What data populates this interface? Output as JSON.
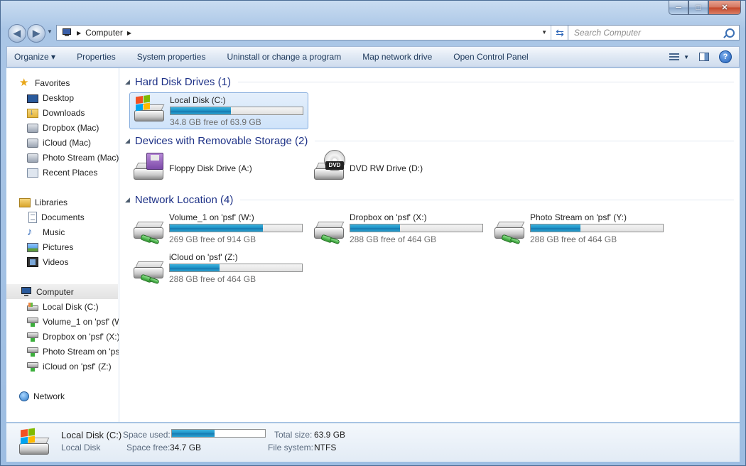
{
  "window": {
    "caption_minimize": "─",
    "caption_maximize": "□",
    "caption_close": "✕"
  },
  "address": {
    "location": "Computer",
    "icon": "computer-icon"
  },
  "search": {
    "placeholder": "Search Computer"
  },
  "toolbar": {
    "organize": "Organize ▾",
    "properties": "Properties",
    "system_properties": "System properties",
    "uninstall": "Uninstall or change a program",
    "map_drive": "Map network drive",
    "control_panel": "Open Control Panel"
  },
  "nav": {
    "favorites": {
      "label": "Favorites",
      "items": [
        {
          "label": "Desktop",
          "icon": "desktop-icon"
        },
        {
          "label": "Downloads",
          "icon": "downloads-icon"
        },
        {
          "label": "Dropbox (Mac)",
          "icon": "dropbox-icon"
        },
        {
          "label": "iCloud (Mac)",
          "icon": "icloud-icon"
        },
        {
          "label": "Photo Stream (Mac)",
          "icon": "photostream-icon"
        },
        {
          "label": "Recent Places",
          "icon": "recent-places-icon"
        }
      ]
    },
    "libraries": {
      "label": "Libraries",
      "items": [
        {
          "label": "Documents",
          "icon": "documents-icon"
        },
        {
          "label": "Music",
          "icon": "music-icon"
        },
        {
          "label": "Pictures",
          "icon": "pictures-icon"
        },
        {
          "label": "Videos",
          "icon": "videos-icon"
        }
      ]
    },
    "computer": {
      "label": "Computer",
      "items": [
        {
          "label": "Local Disk (C:)",
          "icon": "local-disk-icon"
        },
        {
          "label": "Volume_1 on 'psf' (W",
          "icon": "network-drive-icon"
        },
        {
          "label": "Dropbox on 'psf' (X:)",
          "icon": "network-drive-icon"
        },
        {
          "label": "Photo Stream on 'ps",
          "icon": "network-drive-icon"
        },
        {
          "label": "iCloud on 'psf' (Z:)",
          "icon": "network-drive-icon"
        }
      ]
    },
    "network": {
      "label": "Network"
    }
  },
  "groups": {
    "hdd": {
      "title": "Hard Disk Drives (1)",
      "items": [
        {
          "name": "Local Disk (C:)",
          "free": "34.8 GB free of 63.9 GB",
          "used_fraction": 0.455
        }
      ]
    },
    "removable": {
      "title": "Devices with Removable Storage (2)",
      "items": [
        {
          "name": "Floppy Disk Drive (A:)"
        },
        {
          "name": "DVD RW Drive (D:)",
          "badge": "DVD"
        }
      ]
    },
    "network": {
      "title": "Network Location (4)",
      "items": [
        {
          "name": "Volume_1 on 'psf' (W:)",
          "free": "269 GB free of 914 GB",
          "used_fraction": 0.706
        },
        {
          "name": "Dropbox on 'psf' (X:)",
          "free": "288 GB free of 464 GB",
          "used_fraction": 0.379
        },
        {
          "name": "Photo Stream on 'psf' (Y:)",
          "free": "288 GB free of 464 GB",
          "used_fraction": 0.379
        },
        {
          "name": "iCloud on 'psf' (Z:)",
          "free": "288 GB free of 464 GB",
          "used_fraction": 0.379
        }
      ]
    }
  },
  "details": {
    "name": "Local Disk (C:)",
    "type": "Local Disk",
    "space_used_label": "Space used:",
    "space_free_label": "Space free:",
    "space_free": "34.7 GB",
    "total_size_label": "Total size:",
    "total_size": "63.9 GB",
    "file_system_label": "File system:",
    "file_system": "NTFS",
    "used_fraction": 0.457
  },
  "colors": {
    "accent": "#1e3287",
    "progress": "#1a8fc4",
    "selection": "#cfe3fa"
  }
}
